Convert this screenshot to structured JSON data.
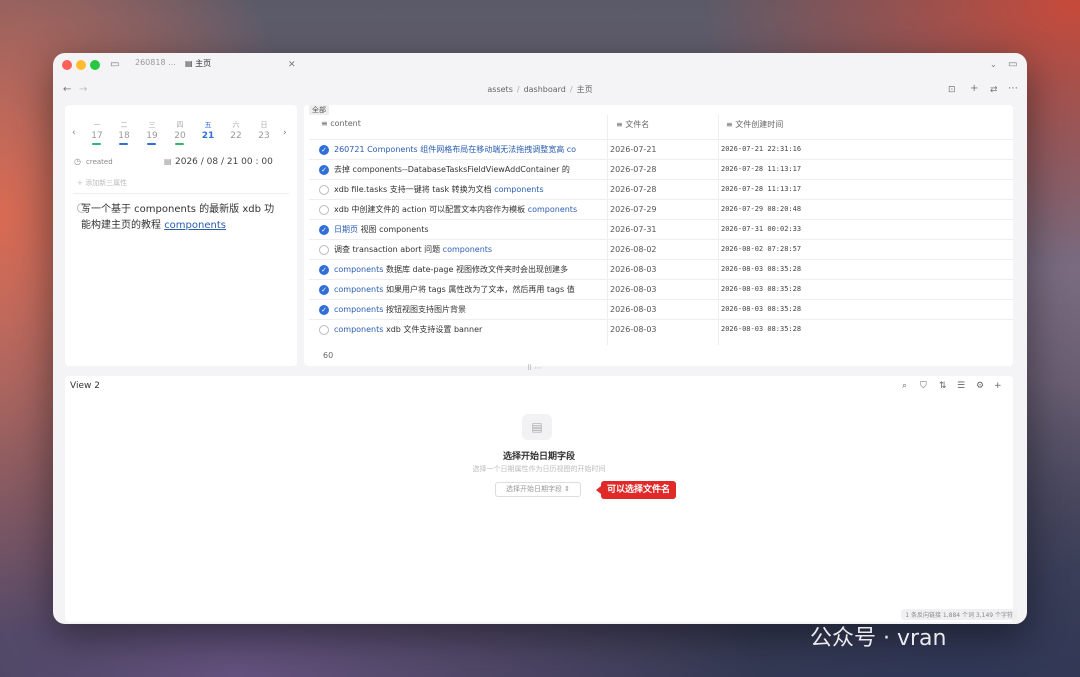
{
  "window": {
    "tabs": [
      {
        "label": "260818 ..."
      },
      {
        "label": "主页"
      }
    ],
    "breadcrumb": [
      "assets",
      "dashboard",
      "主页"
    ]
  },
  "calendar": {
    "weekdays": [
      "一",
      "二",
      "三",
      "四",
      "五",
      "六",
      "日"
    ],
    "days": [
      "17",
      "18",
      "19",
      "20",
      "21",
      "22",
      "23"
    ],
    "field_label": "created",
    "date_value": "2026 / 08 / 21  00 : 00",
    "add_property": "+ 添加新三属性",
    "task": {
      "text": "写一个基于 components 的最新版 xdb 功能构建主页的教程 ",
      "link": "components"
    }
  },
  "table": {
    "tag": "全部",
    "headers": [
      "content",
      "文件名",
      "文件创建时间"
    ],
    "rows": [
      {
        "done": true,
        "pre": "",
        "link": "260721 Components 组件网格布局在移动端无法拖拽调整宽高 co",
        "post": "",
        "name": "2026-07-21",
        "time": "2026-07-21 22:31:16"
      },
      {
        "done": true,
        "pre": "去掉 components--DatabaseTasksFieldViewAddContainer 的 ",
        "link": "",
        "post": "",
        "name": "2026-07-28",
        "time": "2026-07-28 11:13:17"
      },
      {
        "done": false,
        "pre": "xdb file.tasks 支持一键将 task 转换为文档 ",
        "link": "components",
        "post": "",
        "name": "2026-07-28",
        "time": "2026-07-28 11:13:17"
      },
      {
        "done": false,
        "pre": "xdb 中创建文件的 action 可以配置文本内容作为模板 ",
        "link": "components",
        "post": "",
        "name": "2026-07-29",
        "time": "2026-07-29 08:20:48"
      },
      {
        "done": true,
        "pre": "",
        "link": "日期页",
        "post": " 视图 components",
        "name": "2026-07-31",
        "time": "2026-07-31 00:02:33"
      },
      {
        "done": false,
        "pre": "调查 transaction abort 问题 ",
        "link": "components",
        "post": "",
        "name": "2026-08-02",
        "time": "2026-08-02 07:28:57"
      },
      {
        "done": true,
        "pre": "",
        "link": "components",
        "post": " 数据库 date-page 视图修改文件夹时会出现创建多",
        "name": "2026-08-03",
        "time": "2026-08-03 08:35:28"
      },
      {
        "done": true,
        "pre": "",
        "link": "components",
        "post": " 如果用户将 tags 属性改为了文本，然后再用 tags 值",
        "name": "2026-08-03",
        "time": "2026-08-03 08:35:28"
      },
      {
        "done": true,
        "pre": "",
        "link": "components",
        "post": " 按钮视图支持图片背景",
        "name": "2026-08-03",
        "time": "2026-08-03 08:35:28"
      },
      {
        "done": false,
        "pre": "",
        "link": "components",
        "post": " xdb 文件支持设置 banner",
        "name": "2026-08-03",
        "time": "2026-08-03 08:35:28"
      }
    ],
    "count": "60"
  },
  "view2": {
    "title": "View 2",
    "empty_title": "选择开始日期字段",
    "empty_desc": "选择一个日期属性作为日历视图的开始时间",
    "select_label": "选择开始日期字段 ⇕",
    "annotation": "可以选择文件名"
  },
  "statusbar": {
    "text": "1 条反向链接    1,884 个词    3,149 个字符"
  },
  "watermark": "公众号 · vran",
  "colors": {
    "accent": "#2f6fd6",
    "link": "#2a5db0",
    "badge": "#e02a2a"
  },
  "icons": [
    "sidebar-toggle-icon",
    "back-icon",
    "forward-icon",
    "lock-icon",
    "plus-icon",
    "settings-icon",
    "more-icon",
    "search-icon",
    "filter-icon",
    "sort-icon",
    "list-icon",
    "gear-icon",
    "calendar-icon"
  ]
}
